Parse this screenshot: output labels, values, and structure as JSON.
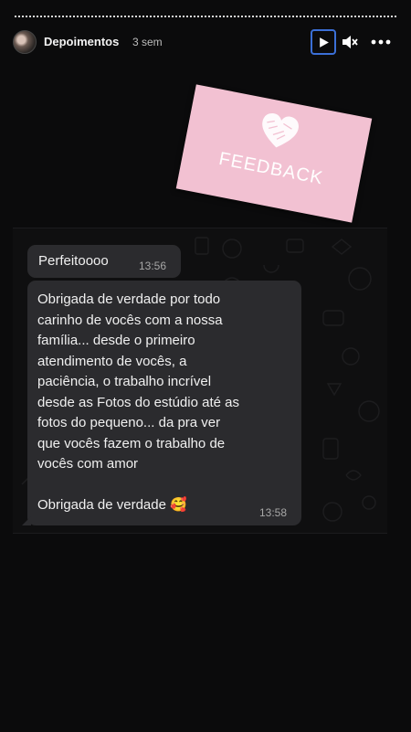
{
  "story": {
    "username": "Depoimentos",
    "time_ago": "3 sem",
    "icons": {
      "play": "play-icon",
      "mute": "mute-icon",
      "more": "more-icon"
    }
  },
  "sticker": {
    "text": "FEEDBACK",
    "background": "#f2c1d2"
  },
  "chat": {
    "messages": [
      {
        "text": "Perfeitoooo",
        "time": "13:56"
      },
      {
        "text": "Obrigada de verdade por todo\ncarinho de vocês com a nossa\nfamília... desde o primeiro\natendimento de vocês, a\npaciência, o trabalho incrível\ndesde as Fotos do estúdio até as\nfotos do pequeno... da pra ver\nque vocês fazem o trabalho de\nvocês com amor\n\nObrigada de verdade 🥰",
        "time": "13:58"
      }
    ]
  }
}
